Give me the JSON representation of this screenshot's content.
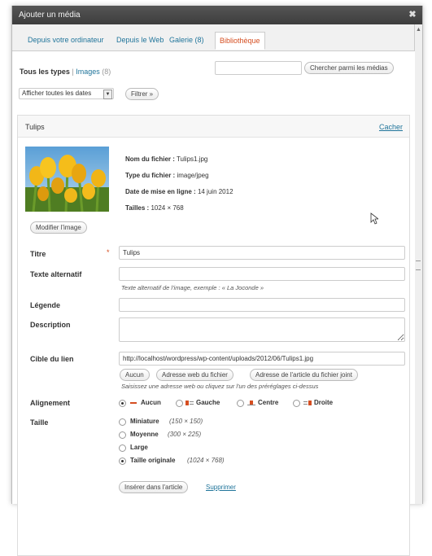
{
  "window": {
    "title": "Ajouter un média",
    "close": "✖"
  },
  "tabs": [
    {
      "label": "Depuis votre ordinateur"
    },
    {
      "label": "Depuis le Web"
    },
    {
      "label": "Galerie (8)"
    },
    {
      "label": "Bibliothèque"
    }
  ],
  "filters": {
    "all_types": "Tous les types",
    "separator": "|",
    "images": "Images",
    "images_count": "(8)",
    "search_placeholder": "",
    "search_button": "Chercher parmi les médias",
    "date_select": "Afficher toutes les dates",
    "filter_button": "Filtrer »"
  },
  "item": {
    "name": "Tulips",
    "hide_link": "Cacher",
    "file_name_label": "Nom du fichier :",
    "file_name": "Tulips1.jpg",
    "file_type_label": "Type du fichier :",
    "file_type": "image/jpeg",
    "upload_date_label": "Date de mise en ligne :",
    "upload_date": "14 juin 2012",
    "size_label": "Tailles :",
    "size": "1024 × 768",
    "edit_image_button": "Modifier l'image"
  },
  "form": {
    "title_label": "Titre",
    "required_mark": "*",
    "title_value": "Tulips",
    "alt_label": "Texte alternatif",
    "alt_value": "",
    "alt_help": "Texte alternatif de l'image, exemple : « La Joconde »",
    "caption_label": "Légende",
    "caption_value": "",
    "description_label": "Description",
    "description_value": "",
    "link_label": "Cible du lien",
    "link_value": "http://localhost/wordpress/wp-content/uploads/2012/06/Tulips1.jpg",
    "link_none": "Aucun",
    "link_file": "Adresse web du fichier",
    "link_post": "Adresse de l'article du fichier joint",
    "link_help": "Saisissez une adresse web ou cliquez sur l'un des préréglages ci-dessus",
    "align_label": "Alignement",
    "align_options": [
      "Aucun",
      "Gauche",
      "Centre",
      "Droite"
    ],
    "align_selected": "Aucun",
    "size_label": "Taille",
    "size_options": [
      {
        "label": "Miniature",
        "dims": "(150 × 150)"
      },
      {
        "label": "Moyenne",
        "dims": "(300 × 225)"
      },
      {
        "label": "Large",
        "dims": ""
      },
      {
        "label": "Taille originale",
        "dims": "(1024 × 768)"
      }
    ],
    "size_selected": "Taille originale",
    "insert_button": "Insérer dans l'article",
    "delete_link": "Supprimer"
  }
}
